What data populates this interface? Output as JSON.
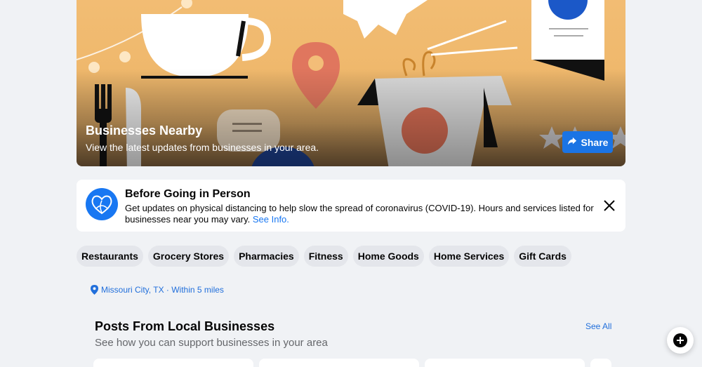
{
  "hero": {
    "title": "Businesses Nearby",
    "subtitle": "View the latest updates from businesses in your area.",
    "share_label": "Share",
    "share_icon": "share-arrow-icon"
  },
  "info_card": {
    "icon": "heart-globe-icon",
    "title": "Before Going in Person",
    "body": "Get updates on physical distancing to help slow the spread of coronavirus (COVID-19). Hours and services listed for businesses near you may vary.",
    "link": "See Info.",
    "close_icon": "close-icon"
  },
  "categories": [
    {
      "label": "Restaurants"
    },
    {
      "label": "Grocery Stores"
    },
    {
      "label": "Pharmacies"
    },
    {
      "label": "Fitness"
    },
    {
      "label": "Home Goods"
    },
    {
      "label": "Home Services"
    },
    {
      "label": "Gift Cards"
    }
  ],
  "location": {
    "icon": "location-pin-icon",
    "text": "Missouri City, TX · Within 5 miles"
  },
  "section": {
    "title": "Posts From Local Businesses",
    "subtitle": "See how you can support businesses in your area",
    "see_all": "See All"
  },
  "fab": {
    "icon": "new-message-icon"
  },
  "colors": {
    "accent": "#1877f2",
    "share_button": "#1b74e4",
    "link": "#216fdb",
    "background": "#f0f2f5",
    "chip": "#e4e6eb"
  }
}
